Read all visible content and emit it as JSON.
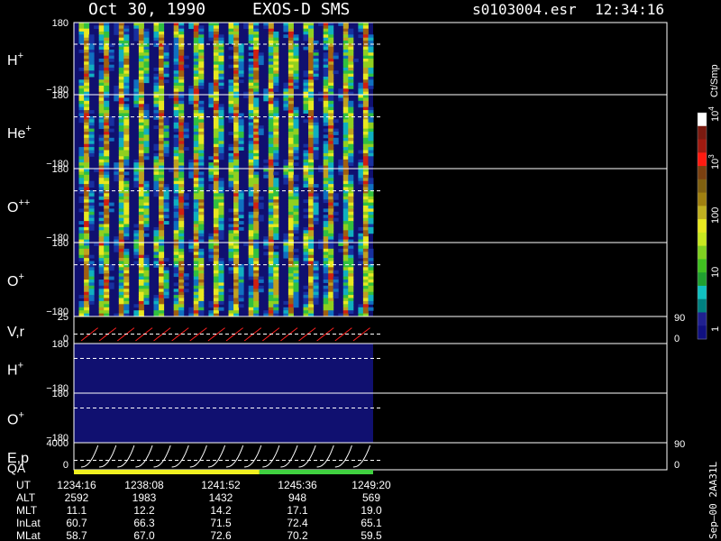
{
  "header": {
    "date": "Oct 30, 1990",
    "instrument": "EXOS-D SMS",
    "file": "s0103004.esr",
    "time": "12:34:16"
  },
  "colorbar": {
    "unit": "Ct/Smp",
    "labels": [
      "1",
      "10",
      "100",
      "10",
      "10"
    ],
    "exponents": [
      "",
      "",
      "",
      "3",
      "4"
    ],
    "colors": [
      "#ffffff",
      "#7a1a10",
      "#a01a10",
      "#ff1a10",
      "#7a4010",
      "#806010",
      "#a08010",
      "#c0b020",
      "#e8e820",
      "#c8e820",
      "#80d020",
      "#40c020",
      "#20a030",
      "#10c0c0",
      "#008080",
      "#202090",
      "#101080"
    ]
  },
  "panels": [
    {
      "id": "h-plus",
      "label": "H",
      "sup": "+",
      "tick_top": "180",
      "tick_bottom": "−180",
      "kind": "spectrogram"
    },
    {
      "id": "he-plus",
      "label": "He",
      "sup": "+",
      "tick_top": "180",
      "tick_bottom": "−180",
      "kind": "spectrogram"
    },
    {
      "id": "o-plusplus",
      "label": "O",
      "sup": "++",
      "tick_top": "180",
      "tick_bottom": "−180",
      "kind": "spectrogram"
    },
    {
      "id": "o-plus",
      "label": "O",
      "sup": "+",
      "tick_top": "180",
      "tick_bottom": "−180",
      "kind": "spectrogram"
    },
    {
      "id": "vr",
      "label": "V,r",
      "sup": "",
      "tick_top": "25",
      "tick_bottom": "0",
      "right_top": "90",
      "right_bottom": "0",
      "kind": "line",
      "color": "#ff2020"
    },
    {
      "id": "h-plus-2",
      "label": "H",
      "sup": "+",
      "tick_top": "180",
      "tick_bottom": "−180",
      "kind": "blank"
    },
    {
      "id": "o-plus-2",
      "label": "O",
      "sup": "+",
      "tick_top": "180",
      "tick_bottom": "−180",
      "kind": "blank"
    },
    {
      "id": "ep",
      "label": "E,p",
      "sup": "",
      "tick_top": "4000",
      "tick_bottom": "0",
      "right_top": "90",
      "right_bottom": "0",
      "kind": "line",
      "color": "#ffffff"
    }
  ],
  "qa": {
    "label": "QA",
    "segments": [
      {
        "from": 0.0,
        "to": 0.62,
        "color": "#f0f020"
      },
      {
        "from": 0.62,
        "to": 1.0,
        "color": "#40d040"
      }
    ]
  },
  "ephemeris": {
    "rows": [
      {
        "name": "UT",
        "values": [
          "1234:16",
          "1238:08",
          "1241:52",
          "1245:36",
          "1249:20"
        ]
      },
      {
        "name": "ALT",
        "values": [
          "2592",
          "1983",
          "1432",
          "948",
          "569"
        ]
      },
      {
        "name": "MLT",
        "values": [
          "11.1",
          "12.2",
          "14.2",
          "17.1",
          "19.0"
        ]
      },
      {
        "name": "InLat",
        "values": [
          "60.7",
          "66.3",
          "71.5",
          "72.4",
          "65.1"
        ]
      },
      {
        "name": "MLat",
        "values": [
          "58.7",
          "67.0",
          "72.6",
          "70.2",
          "59.5"
        ]
      }
    ]
  },
  "footer": "Sep–00 2AA31L",
  "chart_data": {
    "type": "heatmap",
    "xlabel": "UT",
    "spin_count": 16,
    "panels": [
      "H+",
      "He+",
      "O++",
      "O+",
      "V,r",
      "H+",
      "O+",
      "E,p"
    ],
    "colorbar_range": [
      1,
      10000
    ],
    "colorbar_scale": "log"
  }
}
